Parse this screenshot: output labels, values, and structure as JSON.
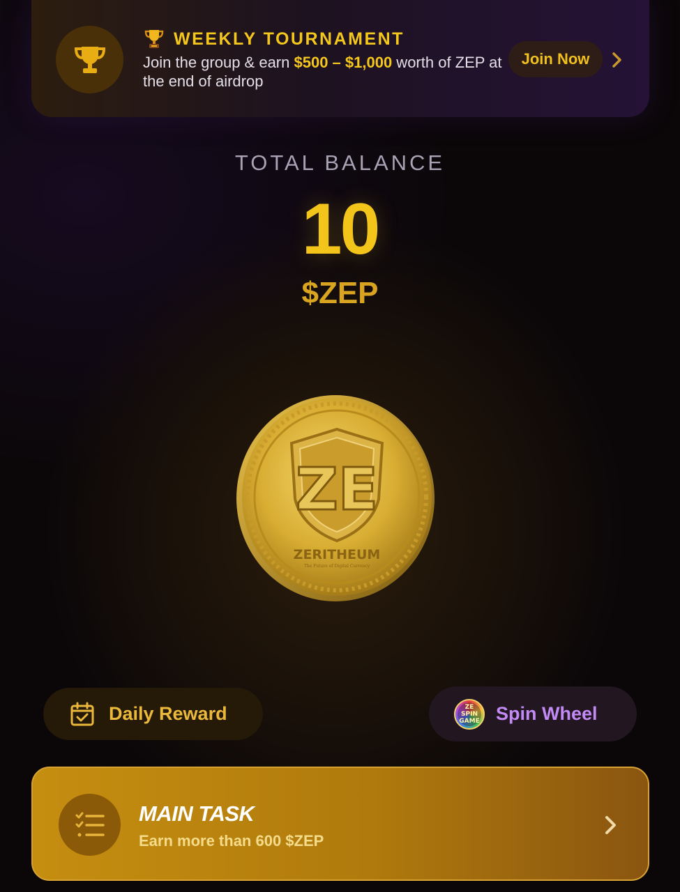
{
  "banner": {
    "title": "WEEKLY TOURNAMENT",
    "title_icon": "trophy-emoji-icon",
    "leading_icon": "trophy-icon",
    "desc_pre": "Join the group & earn ",
    "desc_highlight": "$500 – $1,000",
    "desc_post": " worth of ZEP at the end of airdrop",
    "join_label": "Join Now",
    "chevron_icon": "chevron-right-icon"
  },
  "balance": {
    "label": "TOTAL BALANCE",
    "value": "10",
    "unit": "$ZEP"
  },
  "coin": {
    "name": "ZERITHEUM",
    "monogram": "ZE",
    "tagline": "The Future of Digital Currency"
  },
  "actions": {
    "daily_label": "Daily Reward",
    "daily_icon": "calendar-check-icon",
    "spin_label": "Spin Wheel",
    "spin_logo_text": "ZE SPIN GAME"
  },
  "task": {
    "title": "MAIN TASK",
    "subtitle": "Earn more than 600 $ZEP",
    "icon": "checklist-icon",
    "chevron_icon": "chevron-right-icon"
  },
  "colors": {
    "accent_gold": "#f3c51b",
    "spin_purple": "#c38af6",
    "task_gold": "#c58e10"
  }
}
